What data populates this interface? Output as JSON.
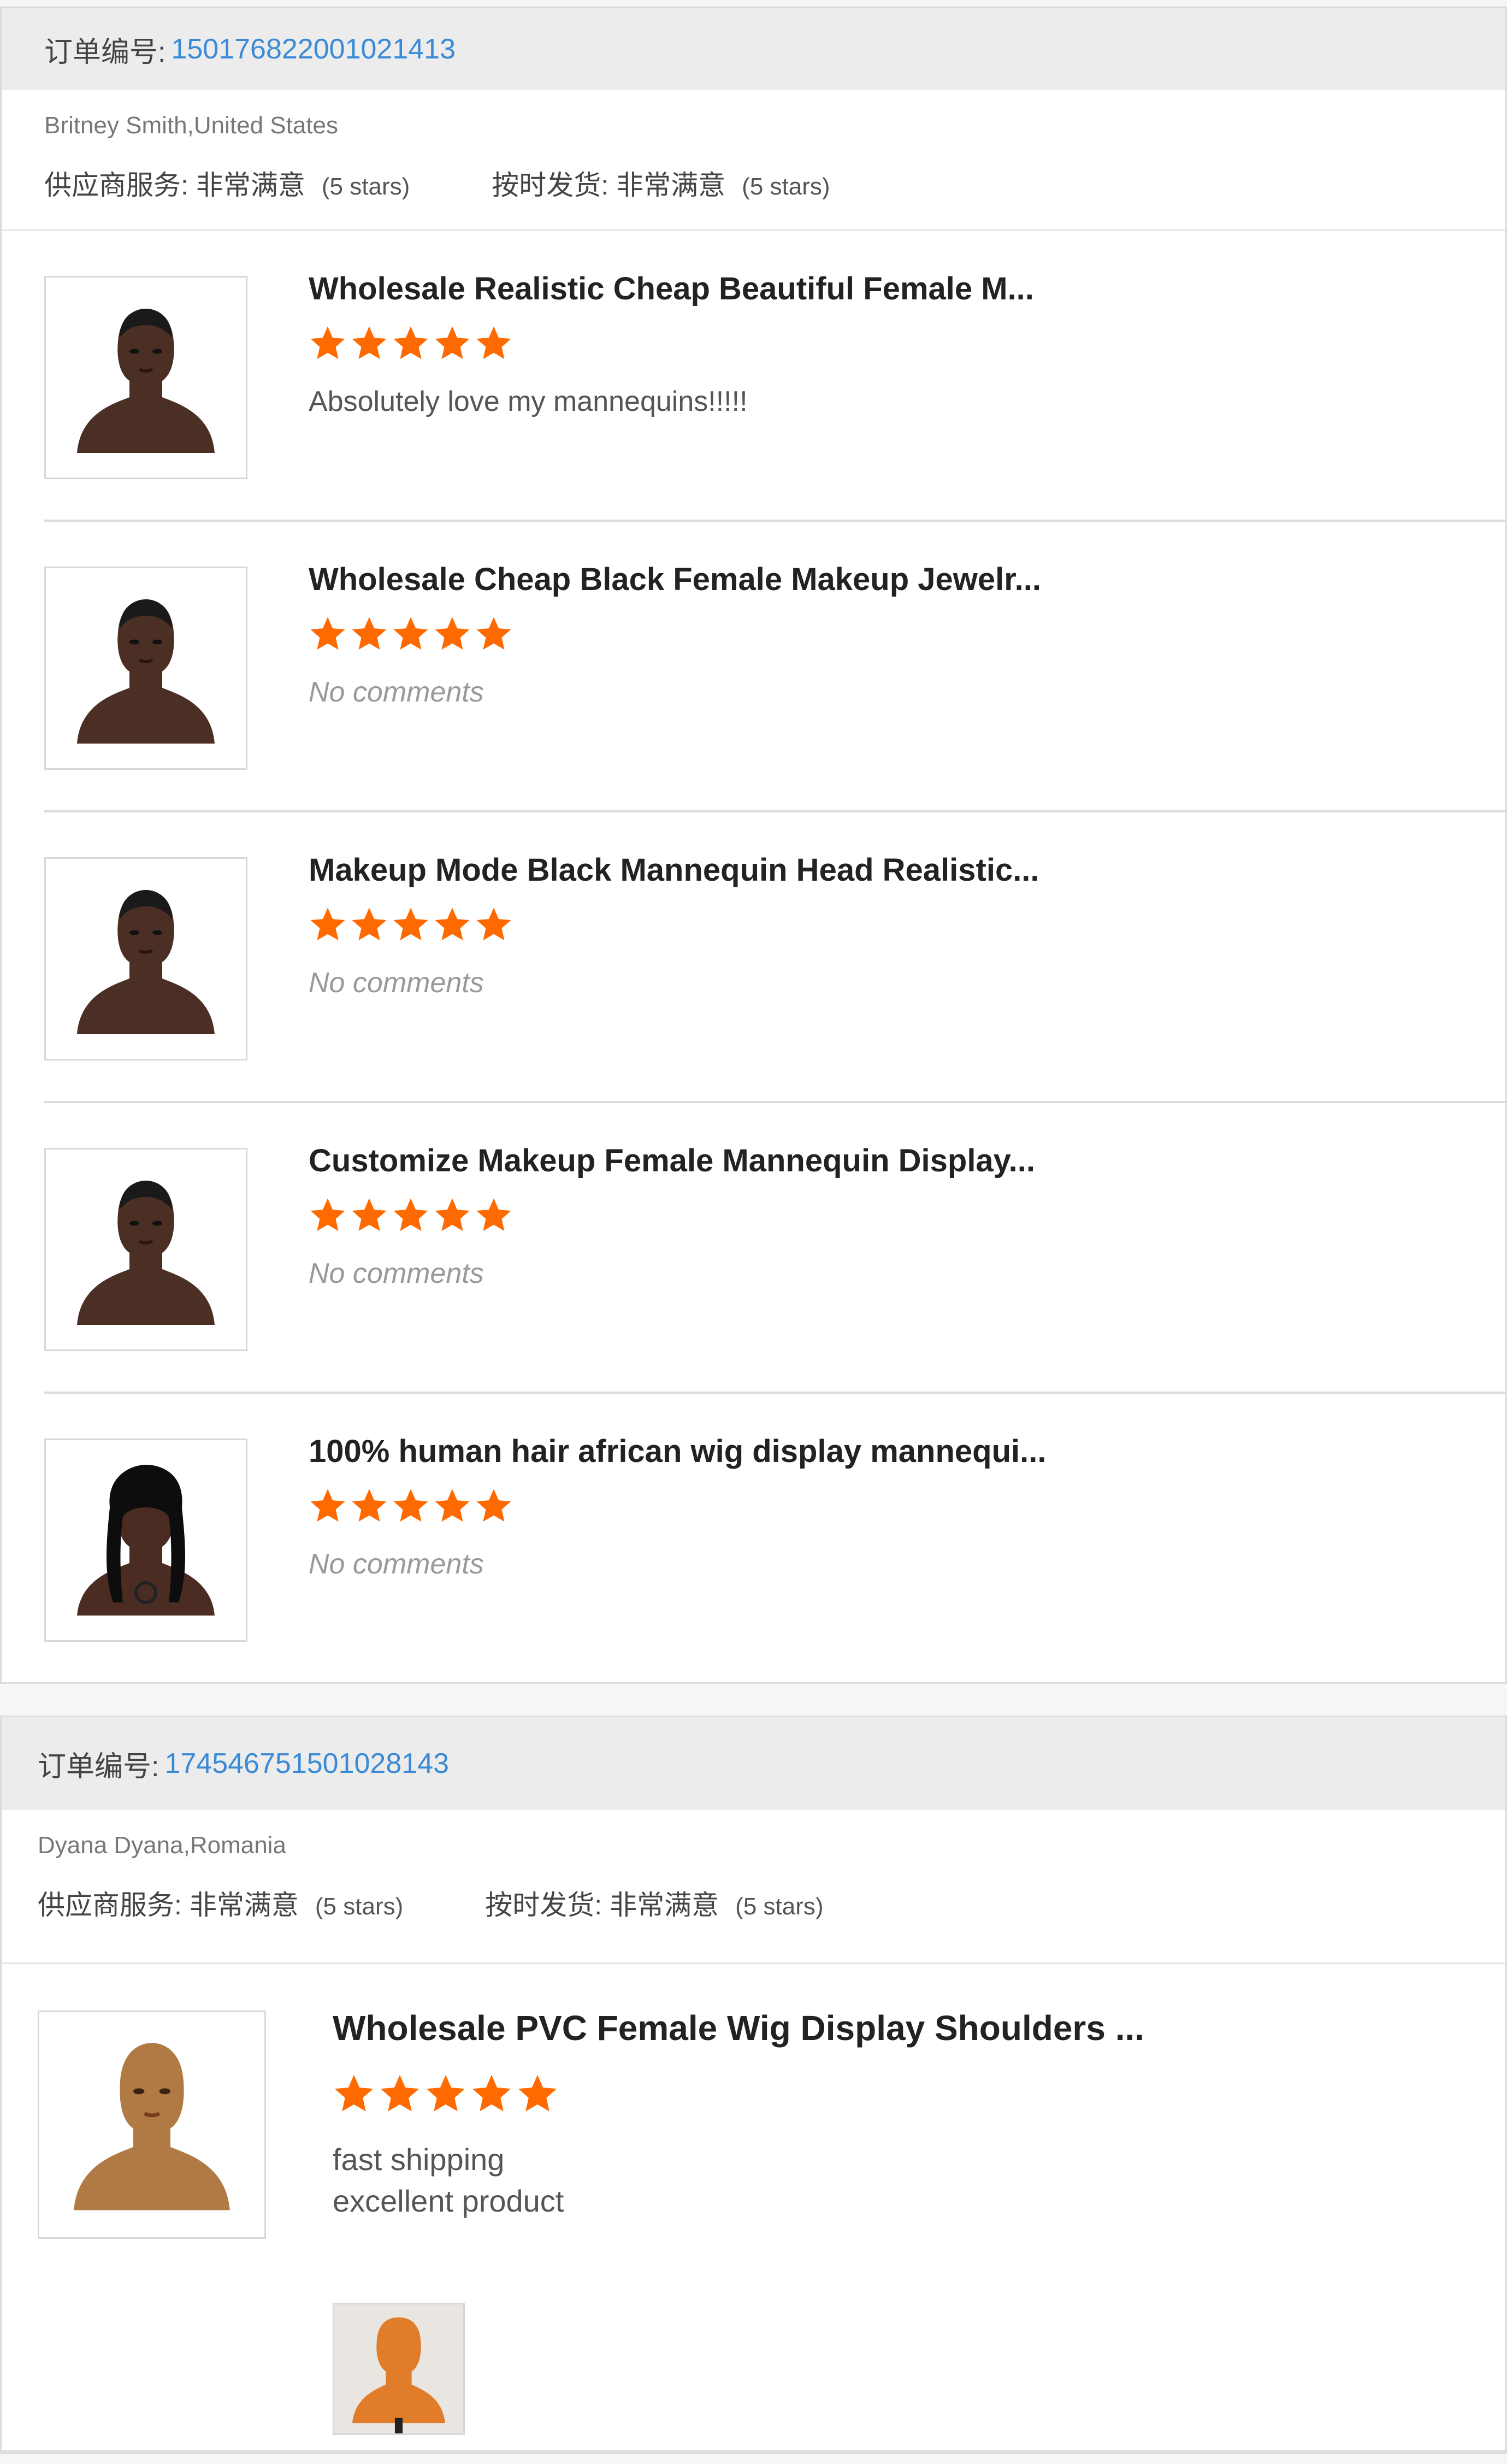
{
  "colors": {
    "accent_link": "#3a8ad6",
    "star": "#ff6a00",
    "header_bg": "#ececec"
  },
  "orders": [
    {
      "order_label": "订单编号:",
      "order_number": "150176822001021413",
      "buyer": "Britney Smith,United States",
      "supplier_service_label": "供应商服务:",
      "supplier_service_value": "非常满意",
      "supplier_service_stars": "(5 stars)",
      "on_time_label": "按时发货:",
      "on_time_value": "非常满意",
      "on_time_stars": "(5 stars)",
      "items": [
        {
          "title": "Wholesale Realistic Cheap Beautiful Female M...",
          "rating": 5,
          "comment": "Absolutely love my mannequins!!!!!",
          "image_icon": "mannequin-head-dark-icon"
        },
        {
          "title": "Wholesale Cheap Black Female Makeup Jewelr...",
          "rating": 5,
          "comment": "No comments",
          "image_icon": "mannequin-head-dark-icon"
        },
        {
          "title": "Makeup Mode Black Mannequin Head Realistic...",
          "rating": 5,
          "comment": "No comments",
          "image_icon": "mannequin-head-dark-icon"
        },
        {
          "title": "Customize Makeup Female Mannequin Display...",
          "rating": 5,
          "comment": "No comments",
          "image_icon": "mannequin-head-dark-icon"
        },
        {
          "title": "100% human hair african wig display mannequi...",
          "rating": 5,
          "comment": "No comments",
          "image_icon": "mannequin-head-wig-icon"
        }
      ]
    },
    {
      "order_label": "订单编号:",
      "order_number": "174546751501028143",
      "buyer": "Dyana Dyana,Romania",
      "supplier_service_label": "供应商服务:",
      "supplier_service_value": "非常满意",
      "supplier_service_stars": "(5 stars)",
      "on_time_label": "按时发货:",
      "on_time_value": "非常满意",
      "on_time_stars": "(5 stars)",
      "items": [
        {
          "title": "Wholesale PVC Female Wig Display Shoulders ...",
          "rating": 5,
          "comment_line1": "fast shipping",
          "comment_line2": "excellent product",
          "image_icon": "mannequin-head-tan-icon",
          "attachment_icon": "mannequin-photo-icon"
        }
      ]
    }
  ]
}
